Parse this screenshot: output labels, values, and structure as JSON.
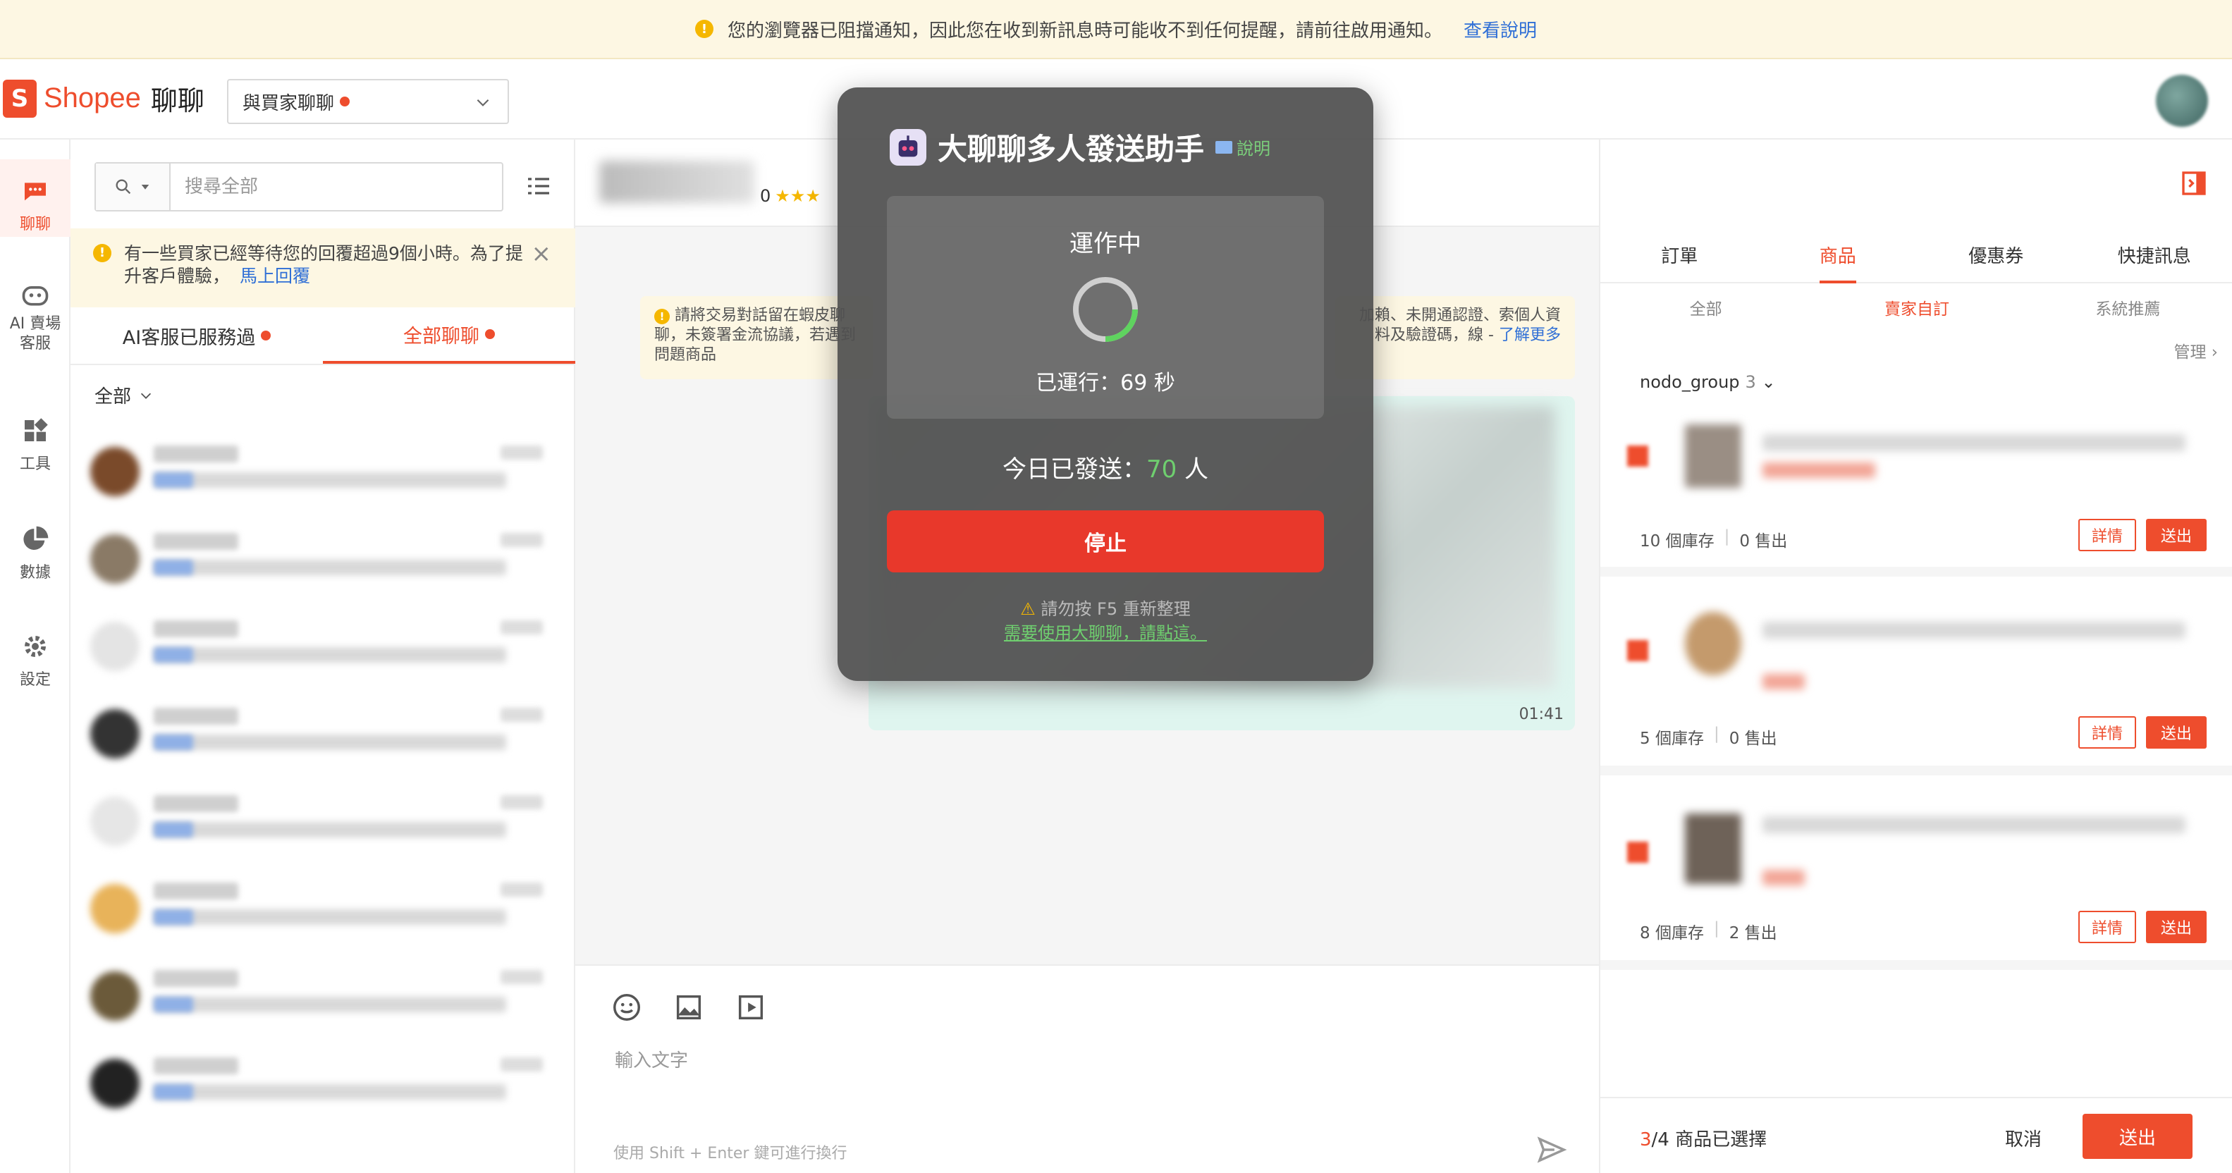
{
  "notice": {
    "text": "您的瀏覽器已阻擋通知，因此您在收到新訊息時可能收不到任何提醒，請前往啟用通知。",
    "link": "查看說明"
  },
  "header": {
    "brand": "Shopee",
    "brand_suffix": "聊聊",
    "chat_select": "與買家聊聊"
  },
  "leftnav": [
    {
      "label": "聊聊",
      "icon": "chat-bubble-icon"
    },
    {
      "label": "AI 賣場客服",
      "icon": "robot-icon"
    },
    {
      "label": "工具",
      "icon": "tools-icon"
    },
    {
      "label": "數據",
      "icon": "pie-chart-icon"
    },
    {
      "label": "設定",
      "icon": "gear-icon"
    }
  ],
  "convlist": {
    "search_placeholder": "搜尋全部",
    "alert_text": "有一些買家已經等待您的回覆超過9個小時。為了提升客戶體驗，",
    "alert_link": "馬上回覆",
    "tabs": [
      "AI客服已服務過",
      "全部聊聊"
    ],
    "filter": "全部"
  },
  "chat": {
    "rating_value": "0",
    "banner_left": "請將交易對話留在蝦皮聊聊，未簽署金流協議，若遇到問題商品",
    "banner_right": "加賴、未開通認證、索個人資料及驗證碼，線 -",
    "banner_right_link": "了解更多",
    "msg_time": "01:41",
    "input_placeholder": "輸入文字",
    "input_hint": "使用 Shift + Enter 鍵可進行換行"
  },
  "rightpanel": {
    "tabs": [
      "訂單",
      "商品",
      "優惠券",
      "快捷訊息"
    ],
    "subtabs": [
      "全部",
      "賣家自訂",
      "系統推薦"
    ],
    "manage": "管理",
    "group_name": "nodo_group",
    "group_count": "3",
    "products": [
      {
        "stock": "10 個庫存",
        "sold": "0 售出"
      },
      {
        "stock": "5 個庫存",
        "sold": "0 售出"
      },
      {
        "stock": "8 個庫存",
        "sold": "2 售出"
      }
    ],
    "detail_label": "詳情",
    "send_label": "送出",
    "selected_count": "3",
    "selected_suffix": "/4 商品已選擇",
    "cancel": "取消",
    "send_all": "送出"
  },
  "modal": {
    "title": "大聊聊多人發送助手",
    "help": "說明",
    "status": "運作中",
    "elapsed": "已運行：69 秒",
    "sent_prefix": "今日已發送：",
    "sent_count": "70",
    "sent_suffix": " 人",
    "stop": "停止",
    "warning": "請勿按 F5 重新整理",
    "promo": "需要使用大聊聊，請點這。"
  },
  "colors": {
    "accent": "#ee4d2d",
    "modal_bg": "#505050",
    "success": "#6fcf6f"
  }
}
